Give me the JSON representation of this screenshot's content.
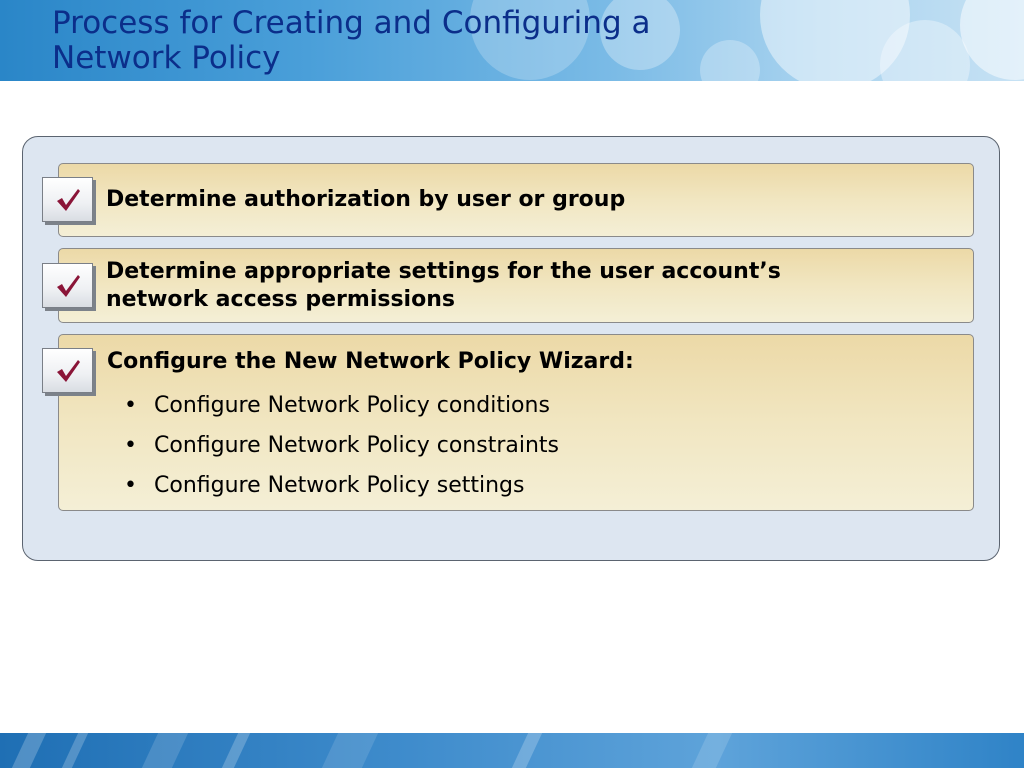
{
  "slide": {
    "title_line1": "Process for Creating and Configuring a",
    "title_line2": "Network Policy"
  },
  "steps": [
    {
      "text": "Determine authorization by user or group",
      "icon": "checkmark-icon"
    },
    {
      "text_line1": "Determine appropriate settings for the user account’s",
      "text_line2": "network access permissions",
      "icon": "checkmark-icon"
    },
    {
      "text": "Configure the New Network Policy Wizard:",
      "icon": "checkmark-icon",
      "bullets": [
        "Configure Network Policy conditions",
        "Configure Network Policy constraints",
        "Configure Network Policy settings"
      ]
    }
  ],
  "colors": {
    "title": "#0b2e8a",
    "check": "#8a1538",
    "panel": "#dde6f1",
    "item": "#f1e6c1"
  }
}
